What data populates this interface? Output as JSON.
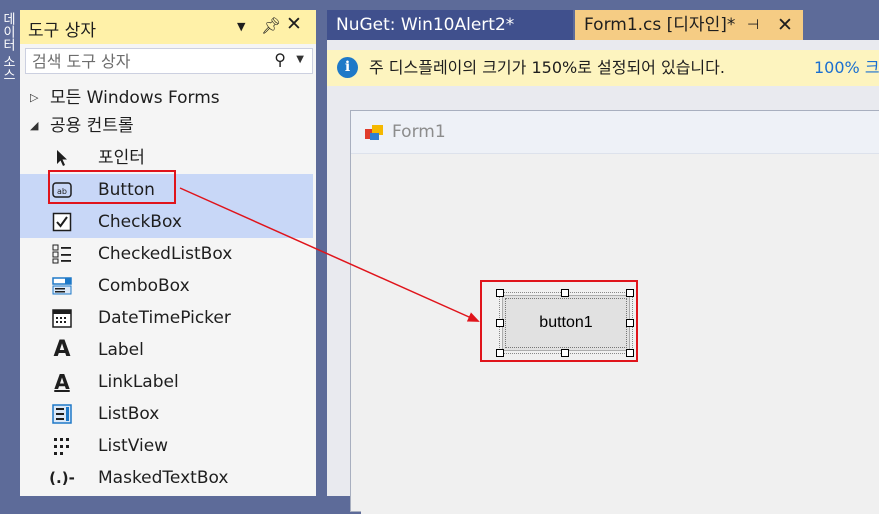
{
  "left_strip": {
    "text": "데이터 소스"
  },
  "toolbox": {
    "title": "도구 상자",
    "search_placeholder": "검색 도구 상자",
    "groups": [
      {
        "label": "모든 Windows Forms",
        "expanded": false
      },
      {
        "label": "공용 컨트롤",
        "expanded": true
      }
    ],
    "items": [
      {
        "label": "포인터",
        "icon": "pointer-icon"
      },
      {
        "label": "Button",
        "icon": "button-icon"
      },
      {
        "label": "CheckBox",
        "icon": "checkbox-icon"
      },
      {
        "label": "CheckedListBox",
        "icon": "checkedlistbox-icon"
      },
      {
        "label": "ComboBox",
        "icon": "combobox-icon"
      },
      {
        "label": "DateTimePicker",
        "icon": "datetimepicker-icon"
      },
      {
        "label": "Label",
        "icon": "label-icon"
      },
      {
        "label": "LinkLabel",
        "icon": "linklabel-icon"
      },
      {
        "label": "ListBox",
        "icon": "listbox-icon"
      },
      {
        "label": "ListView",
        "icon": "listview-icon"
      },
      {
        "label": "MaskedTextBox",
        "icon": "maskedtextbox-icon"
      }
    ],
    "icons": {
      "arrow_expanded": "◢",
      "arrow_collapsed": "▷"
    }
  },
  "editor": {
    "tabs": [
      {
        "label": "NuGet: Win10Alert2*",
        "active": false
      },
      {
        "label": "Form1.cs [디자인]*",
        "active": true
      }
    ],
    "infobar": {
      "text": "주 디스플레이의 크기가 150%로 설정되어 있습니다.",
      "link": "100% 크"
    },
    "form": {
      "title": "Form1",
      "button_label": "button1"
    }
  },
  "colors": {
    "accent_tab": "#f5cc84",
    "selection": "#c8d7f7",
    "highlight_red": "#e0141b",
    "info_blue": "#1e79c8",
    "chrome": "#5d6b99"
  }
}
